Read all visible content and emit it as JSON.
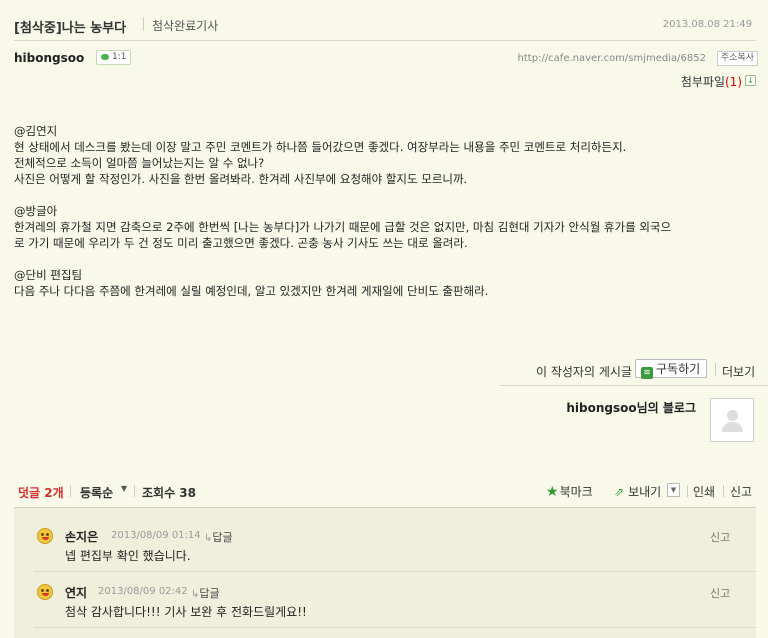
{
  "post": {
    "title": "[첨삭중]나는 농부다",
    "category": "첨삭완료기사",
    "date": "2013.08.08 21:49",
    "author": "hibongsoo",
    "comment_chip": "1:1",
    "url": "http://cafe.naver.com/smjmedia/6852",
    "copy_url_label": "주소복사",
    "attachment_label": "첨부파일",
    "attachment_count": "(1)",
    "body_lines": [
      "@김연지",
      "현 상태에서 데스크를 봤는데 이장 말고 주민 코멘트가 하나쯤 들어갔으면 좋겠다. 여장부라는 내용을 주민 코멘트로 처리하든지.",
      "전체적으로 소득이 얼마쯤 늘어났는지는 알 수 없나?",
      "사진은 어떻게 할 작정인가. 사진을 한번 올려봐라. 한겨레 사진부에 요청해야 할지도 모르니까.",
      "",
      "@방글아",
      "한겨레의 휴가철 지면 감축으로 2주에 한번씩 [나는 농부다]가 나가기 때문에 급할 것은 없지만, 마침 김현대 기자가 안식월 휴가를 외국으",
      "로 가기 때문에 우리가 두 건 정도 미리 출고했으면 좋겠다. 곤충 농사 기사도 쓰는 대로 올려라.",
      "",
      "@단비 편집팀",
      "다음 주나 다다음 주쯤에 한겨레에 실릴 예정인데, 알고 있겠지만 한겨레 게재일에 단비도 출판해라."
    ]
  },
  "author_tools": {
    "posts_label": "이 작성자의 게시글",
    "subscribe_label": "구독하기",
    "more_label": "더보기",
    "blog_name": "hibongsoo님의 블로그"
  },
  "comment_bar": {
    "comments_label": "덧글 2개",
    "sort_label": "등록순",
    "views_label": "조회수 38",
    "bookmark_label": "북마크",
    "send_label": "보내기",
    "print_label": "인쇄",
    "report_label": "신고"
  },
  "comments": [
    {
      "author": "손지은",
      "date": "2013/08/09 01:14",
      "reply_label": "답글",
      "text": "넵 편집부 확인 했습니다.",
      "report_label": "신고"
    },
    {
      "author": "연지",
      "date": "2013/08/09 02:42",
      "reply_label": "답글",
      "text": "첨삭 감사합니다!!! 기사 보완 후 전화드릴게요!!",
      "report_label": "신고"
    }
  ],
  "colors": {
    "page_bg": "#f9f9ea",
    "comment_box_bg": "#efefdc",
    "accent_red": "#d03030",
    "accent_green": "#2e9a2e"
  }
}
